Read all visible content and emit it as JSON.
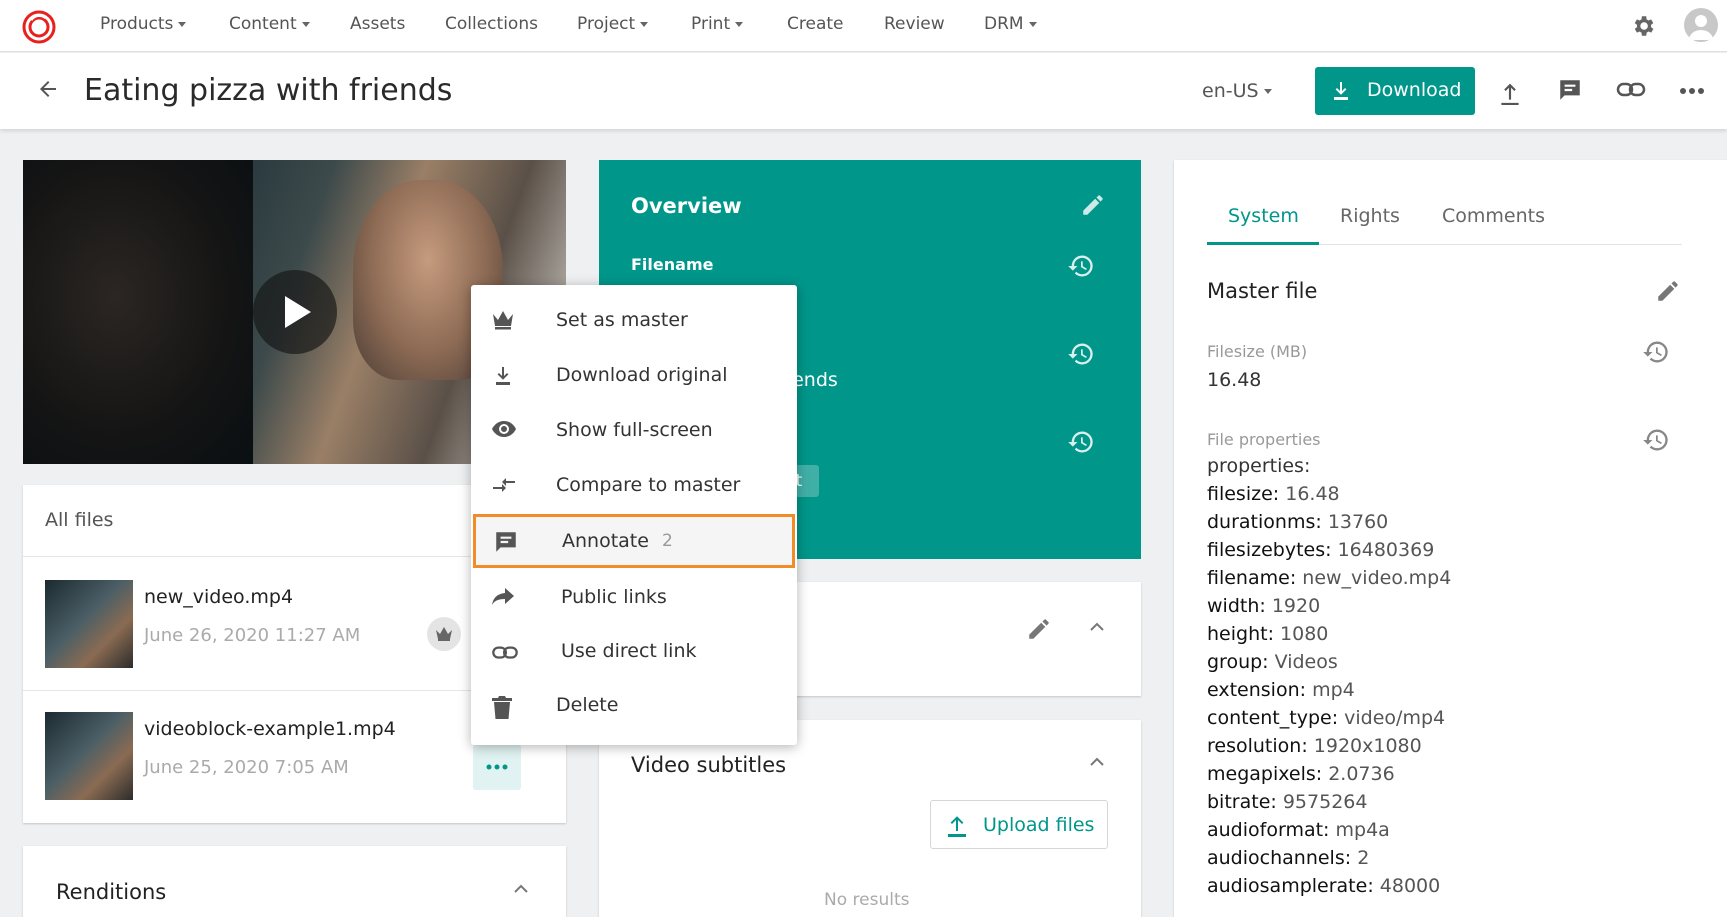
{
  "nav": {
    "items": [
      {
        "label": "Products",
        "dropdown": true
      },
      {
        "label": "Content",
        "dropdown": true
      },
      {
        "label": "Assets",
        "dropdown": false
      },
      {
        "label": "Collections",
        "dropdown": false
      },
      {
        "label": "Project",
        "dropdown": true
      },
      {
        "label": "Print",
        "dropdown": true
      },
      {
        "label": "Create",
        "dropdown": false
      },
      {
        "label": "Review",
        "dropdown": false
      },
      {
        "label": "DRM",
        "dropdown": true
      }
    ],
    "brand_color": "#e8201e"
  },
  "header": {
    "title": "Eating pizza with friends",
    "locale": "en-US",
    "download_label": "Download",
    "accent": "#00968a"
  },
  "files": {
    "title": "All files",
    "items": [
      {
        "name": "new_video.mp4",
        "date": "June 26, 2020 11:27 AM"
      },
      {
        "name": "videoblock-example1.mp4",
        "date": "June 25, 2020 7:05 AM"
      }
    ]
  },
  "renditions": {
    "title": "Renditions"
  },
  "overview": {
    "title": "Overview",
    "filename_label": "Filename",
    "partial_text": "riends",
    "partial_chip": "et"
  },
  "subtitles": {
    "title": "Video subtitles",
    "upload_label": "Upload files",
    "empty": "No results"
  },
  "context_menu": {
    "items": [
      {
        "label": "Set as master",
        "icon": "crown-icon"
      },
      {
        "label": "Download original",
        "icon": "download-icon"
      },
      {
        "label": "Show full-screen",
        "icon": "eye-icon"
      },
      {
        "label": "Compare to master",
        "icon": "compare-icon"
      },
      {
        "label": "Annotate",
        "icon": "comment-icon",
        "count": "2",
        "highlighted": true
      },
      {
        "label": "Public links",
        "icon": "share-icon"
      },
      {
        "label": "Use direct link",
        "icon": "link-icon"
      },
      {
        "label": "Delete",
        "icon": "trash-icon"
      }
    ],
    "highlight_color": "#f28c28"
  },
  "right_panel": {
    "tabs": [
      "System",
      "Rights",
      "Comments"
    ],
    "active_tab": "System",
    "master_file": "Master file",
    "filesize_label": "Filesize (MB)",
    "filesize_value": "16.48",
    "file_props_label": "File properties",
    "props_header": "properties:",
    "props": [
      {
        "k": "filesize:",
        "v": "16.48"
      },
      {
        "k": "durationms:",
        "v": "13760"
      },
      {
        "k": "filesizebytes:",
        "v": "16480369"
      },
      {
        "k": "filename:",
        "v": "new_video.mp4"
      },
      {
        "k": "width:",
        "v": "1920"
      },
      {
        "k": "height:",
        "v": "1080"
      },
      {
        "k": "group:",
        "v": "Videos"
      },
      {
        "k": "extension:",
        "v": "mp4"
      },
      {
        "k": "content_type:",
        "v": "video/mp4"
      },
      {
        "k": "resolution:",
        "v": "1920x1080"
      },
      {
        "k": "megapixels:",
        "v": "2.0736"
      },
      {
        "k": "bitrate:",
        "v": "9575264"
      },
      {
        "k": "audioformat:",
        "v": "mp4a"
      },
      {
        "k": "audiochannels:",
        "v": "2"
      },
      {
        "k": "audiosamplerate:",
        "v": "48000"
      }
    ]
  }
}
